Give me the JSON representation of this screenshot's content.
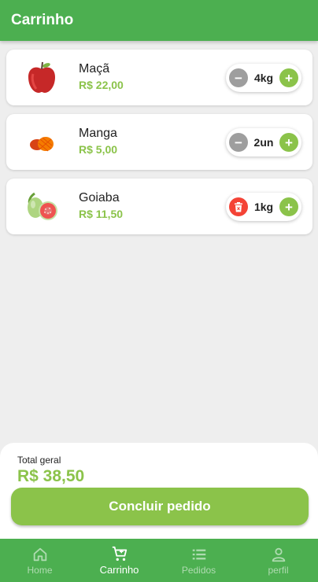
{
  "appbar": {
    "title": "Carrinho"
  },
  "cart": {
    "items": [
      {
        "name": "Maçã",
        "price": "R$ 22,00",
        "quantity": "4kg",
        "left_action": "minus",
        "fruit_icon": "apple-icon"
      },
      {
        "name": "Manga",
        "price": "R$ 5,00",
        "quantity": "2un",
        "left_action": "minus",
        "fruit_icon": "mango-icon"
      },
      {
        "name": "Goiaba",
        "price": "R$ 11,50",
        "quantity": "1kg",
        "left_action": "delete",
        "fruit_icon": "guava-icon"
      }
    ]
  },
  "summary": {
    "total_label": "Total geral",
    "total_value": "R$ 38,50",
    "checkout_label": "Concluir pedido"
  },
  "nav": {
    "items": [
      {
        "label": "Home",
        "icon": "home-icon",
        "active": false
      },
      {
        "label": "Carrinho",
        "icon": "cart-icon",
        "active": true
      },
      {
        "label": "Pedidos",
        "icon": "list-icon",
        "active": false
      },
      {
        "label": "perfil",
        "icon": "user-icon",
        "active": false
      }
    ]
  },
  "colors": {
    "appbar": "#4caf50",
    "accent": "#8bc34a",
    "minus": "#9e9e9e",
    "delete": "#f44336",
    "background": "#eeeeee"
  }
}
